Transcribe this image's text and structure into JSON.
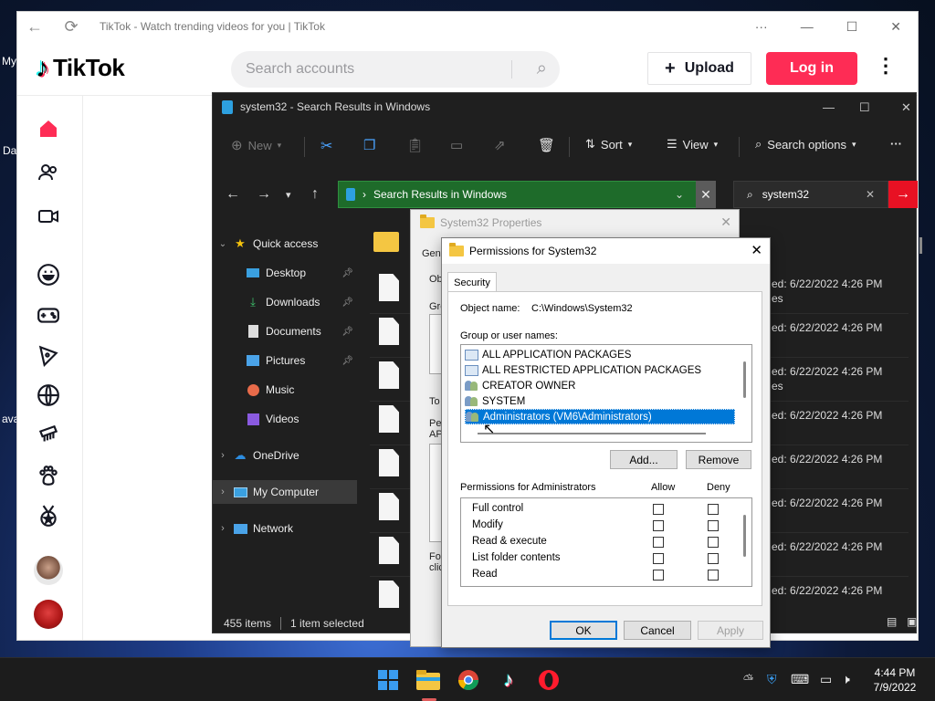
{
  "desktop": {
    "labels": [
      "My",
      "Da",
      "ava"
    ]
  },
  "tiktok": {
    "tab_title": "TikTok - Watch trending videos for you | TikTok",
    "logo_text": "TikTok",
    "search_placeholder": "Search accounts",
    "upload_label": "Upload",
    "login_label": "Log in",
    "sidebar_icons": [
      "home-icon",
      "following-icon",
      "live-icon",
      "comedy-icon",
      "gaming-icon",
      "food-icon",
      "sports-icon",
      "beauty-icon",
      "animals-icon",
      "achievement-icon"
    ]
  },
  "explorer": {
    "title": "system32 - Search Results in Windows",
    "toolbar": {
      "new_label": "New",
      "sort_label": "Sort",
      "view_label": "View",
      "search_options_label": "Search options"
    },
    "address": "Search Results in Windows",
    "search_value": "system32",
    "nav": [
      {
        "label": "Quick access",
        "icon": "star-icon"
      },
      {
        "label": "Desktop",
        "icon": "desktop-icon",
        "pinned": true
      },
      {
        "label": "Downloads",
        "icon": "download-icon",
        "pinned": true
      },
      {
        "label": "Documents",
        "icon": "document-icon",
        "pinned": true
      },
      {
        "label": "Pictures",
        "icon": "picture-icon",
        "pinned": true
      },
      {
        "label": "Music",
        "icon": "music-icon"
      },
      {
        "label": "Videos",
        "icon": "video-icon"
      },
      {
        "label": "OneDrive",
        "icon": "cloud-icon"
      },
      {
        "label": "My Computer",
        "icon": "computer-icon"
      },
      {
        "label": "Network",
        "icon": "network-icon"
      }
    ],
    "files": [
      {
        "modified": "ed: 6/22/2022 4:26 PM",
        "extra": "es"
      },
      {
        "modified": "ed: 6/22/2022 4:26 PM",
        "extra": ""
      },
      {
        "modified": "ed: 6/22/2022 4:26 PM",
        "extra": "es"
      },
      {
        "modified": "ed: 6/22/2022 4:26 PM",
        "extra": ""
      },
      {
        "modified": "ed: 6/22/2022 4:26 PM",
        "extra": ""
      },
      {
        "modified": "ed: 6/22/2022 4:26 PM",
        "extra": ""
      },
      {
        "modified": "ed: 6/22/2022 4:26 PM",
        "extra": ""
      },
      {
        "modified": "ed: 6/22/2022 4:26 PM",
        "extra": ""
      }
    ],
    "status_items": "455 items",
    "status_selected": "1 item selected"
  },
  "properties": {
    "title": "System32 Properties",
    "fragments": [
      "Gen",
      "Ob",
      "Gro",
      "To",
      "Pe",
      "AP",
      "For",
      "clic"
    ]
  },
  "permissions": {
    "title": "Permissions for System32",
    "tab": "Security",
    "object_label": "Object name:",
    "object_value": "C:\\Windows\\System32",
    "group_label": "Group or user names:",
    "groups": [
      {
        "name": "ALL APPLICATION PACKAGES",
        "icon": "package-icon"
      },
      {
        "name": "ALL RESTRICTED APPLICATION PACKAGES",
        "icon": "package-icon"
      },
      {
        "name": "CREATOR OWNER",
        "icon": "users-icon"
      },
      {
        "name": "SYSTEM",
        "icon": "users-icon"
      },
      {
        "name": "Administrators (VM6\\Administrators)",
        "icon": "users-icon",
        "selected": true
      }
    ],
    "add_label": "Add...",
    "remove_label": "Remove",
    "perm_for_label": "Permissions for Administrators",
    "allow_label": "Allow",
    "deny_label": "Deny",
    "permissions": [
      {
        "name": "Full control",
        "allow": false,
        "deny": false
      },
      {
        "name": "Modify",
        "allow": false,
        "deny": false
      },
      {
        "name": "Read & execute",
        "allow": false,
        "deny": false
      },
      {
        "name": "List folder contents",
        "allow": false,
        "deny": false
      },
      {
        "name": "Read",
        "allow": false,
        "deny": false
      }
    ],
    "ok_label": "OK",
    "cancel_label": "Cancel",
    "apply_label": "Apply"
  },
  "taskbar": {
    "apps": [
      "windows-start-icon",
      "file-explorer-icon",
      "chrome-icon",
      "tiktok-icon",
      "opera-icon"
    ],
    "time": "4:44 PM",
    "date": "7/9/2022"
  }
}
